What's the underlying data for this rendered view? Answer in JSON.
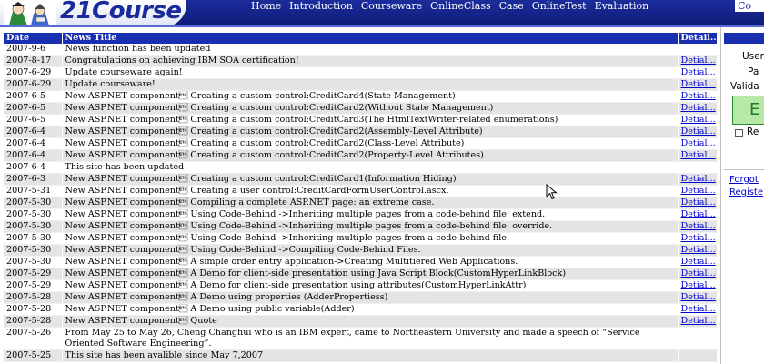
{
  "header": {
    "logo_text": "21Course",
    "nav": [
      "Home",
      "Introduction",
      "Courseware",
      "OnlineClass",
      "Case",
      "OnlineTest",
      "Evaluation"
    ],
    "nav_tail": "Co"
  },
  "table": {
    "headers": {
      "date": "Date",
      "title": "News Title",
      "detail": "Detail..."
    },
    "rows": [
      {
        "date": "2007-9-6",
        "title": "News function has been updated",
        "detail": ""
      },
      {
        "date": "2007-8-17",
        "title": "Congratulations on achieving IBM SOA certification!",
        "detail": "Detial..."
      },
      {
        "date": "2007-6-29",
        "title": "Update courseware again!",
        "detail": "Detial..."
      },
      {
        "date": "2007-6-29",
        "title": "Update courseware!",
        "detail": "Detial..."
      },
      {
        "date": "2007-6-5",
        "title": "New ASP.NET component\u0003   Creating a custom control:CreditCard4(State Management)",
        "detail": "Detial..."
      },
      {
        "date": "2007-6-5",
        "title": "New ASP.NET component\u0003   Creating a custom control:CreditCard2(Without State Management)",
        "detail": "Detial..."
      },
      {
        "date": "2007-6-5",
        "title": "New ASP.NET component\u0003   Creating a custom control:CreditCard3(The HtmlTextWriter-related enumerations)",
        "detail": "Detial..."
      },
      {
        "date": "2007-6-4",
        "title": "New ASP.NET component\u0003   Creating a custom control:CreditCard2(Assembly-Level Attribute)",
        "detail": "Detial..."
      },
      {
        "date": "2007-6-4",
        "title": "New ASP.NET component\u0003   Creating a custom control:CreditCard2(Class-Level Attribute)",
        "detail": "Detial..."
      },
      {
        "date": "2007-6-4",
        "title": "New ASP.NET component\u0003   Creating a custom control:CreditCard2(Property-Level Attributes)",
        "detail": "Detial..."
      },
      {
        "date": "2007-6-4",
        "title": "This site has been updated",
        "detail": ""
      },
      {
        "date": "2007-6-3",
        "title": "New ASP.NET component\u0003   Creating a custom control:CreditCard1(Information Hiding)",
        "detail": "Detial..."
      },
      {
        "date": "2007-5-31",
        "title": "New ASP.NET component\u0003   Creating a user control:CreditCardFormUserControl.ascx.",
        "detail": "Detial..."
      },
      {
        "date": "2007-5-30",
        "title": "New ASP.NET component\u0003   Compiling a complete ASP.NET page: an extreme case.",
        "detail": "Detial..."
      },
      {
        "date": "2007-5-30",
        "title": "New ASP.NET component\u0003   Using Code-Behind ->Inheriting multiple pages from a code-behind file: extend.",
        "detail": "Detial..."
      },
      {
        "date": "2007-5-30",
        "title": "New ASP.NET component\u0003   Using Code-Behind ->Inheriting multiple pages from a code-behind file: override.",
        "detail": "Detial..."
      },
      {
        "date": "2007-5-30",
        "title": "New ASP.NET component\u0003   Using Code-Behind ->Inheriting multiple pages from a code-behind file.",
        "detail": "Detial..."
      },
      {
        "date": "2007-5-30",
        "title": "New ASP.NET component\u0003   Using Code-Behind ->Compiling Code-Behind Files.",
        "detail": "Detial..."
      },
      {
        "date": "2007-5-30",
        "title": "New ASP.NET component\u0003   A simple order entry application->Creating Multitiered Web Applications.",
        "detail": "Detial..."
      },
      {
        "date": "2007-5-29",
        "title": "New ASP.NET component\u0003   A Demo for client-side presentation using Java Script Block(CustomHyperLinkBlock)",
        "detail": "Detial..."
      },
      {
        "date": "2007-5-29",
        "title": "New ASP.NET component\u0003   A Demo for client-side presentation using attributes(CustomHyperLinkAttr)",
        "detail": "Detial..."
      },
      {
        "date": "2007-5-28",
        "title": "New ASP.NET component\u0003   A Demo using properties (AdderPropertiess)",
        "detail": "Detial..."
      },
      {
        "date": "2007-5-28",
        "title": "New ASP.NET component\u0003   A Demo using public variable(Adder)",
        "detail": "Detial..."
      },
      {
        "date": "2007-5-28",
        "title": "New ASP.NET component\u0003   Quote",
        "detail": "Detial..."
      },
      {
        "date": "2007-5-26",
        "title": "From May 25 to May 26, Cheng Changhui who is an IBM expert, came to Northeastern University and made a speech of “Service Oriented Software Engineering”.",
        "detail": "",
        "wrap": true
      },
      {
        "date": "2007-5-25",
        "title": "This site has been avalible since May 7,2007",
        "detail": ""
      }
    ]
  },
  "login": {
    "user_label": "User",
    "pass_label": "Pa",
    "valid_label": "Valida",
    "button_label": "E",
    "remember_label": "Re",
    "forgot_label": "Forgot",
    "register_label": "Registe"
  },
  "colors": {
    "header_bg": "#1830b0",
    "row_alt": "#e4e4e4",
    "link": "#0000cc",
    "button_bg": "#b8e8a8"
  }
}
